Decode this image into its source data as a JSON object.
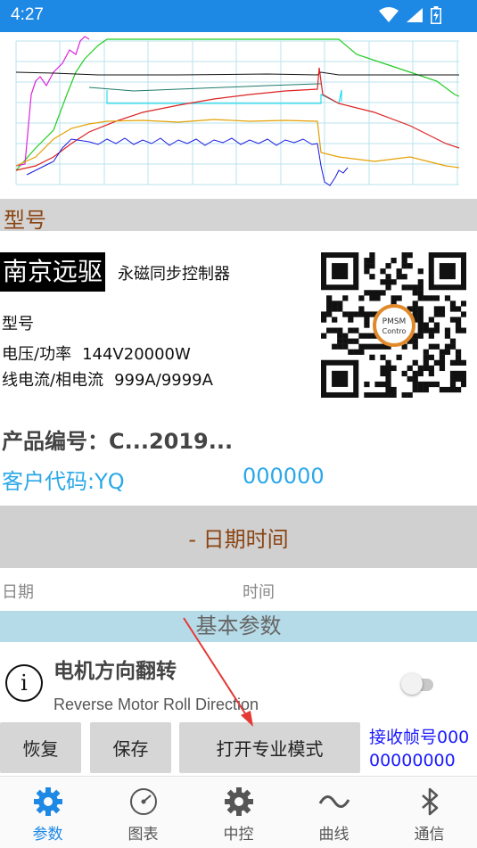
{
  "status": {
    "time": "4:27"
  },
  "model_section": {
    "title": "型号"
  },
  "device": {
    "brand": "南京远驱",
    "brand_suffix": "永磁同步控制器",
    "model_label": "型号",
    "voltage_label": "电压/功率",
    "voltage_value": "144V20000W",
    "current_label": "线电流/相电流",
    "current_value": "999A/9999A",
    "qr_logo_line1": "PMSM",
    "qr_logo_line2": "Contro"
  },
  "product": {
    "label": "产品编号：C...2019..."
  },
  "client": {
    "label": "客户代码:YQ",
    "number": "000000"
  },
  "datetime": {
    "button_label": "- 日期时间",
    "date_hint": "日期",
    "time_hint": "时间"
  },
  "basic_params": {
    "title": "基本参数"
  },
  "setting": {
    "title": "电机方向翻转",
    "subtitle": "Reverse Motor Roll Direction",
    "toggle_on": false
  },
  "buttons": {
    "restore": "恢复",
    "save": "保存",
    "pro_mode": "打开专业模式"
  },
  "frames": {
    "text": "接收帧号00000000000"
  },
  "nav": [
    {
      "label": "参数",
      "icon": "gear-icon",
      "active": true
    },
    {
      "label": "图表",
      "icon": "gauge-icon",
      "active": false
    },
    {
      "label": "中控",
      "icon": "gear-icon",
      "active": false
    },
    {
      "label": "曲线",
      "icon": "wave-icon",
      "active": false
    },
    {
      "label": "通信",
      "icon": "bluetooth-icon",
      "active": false
    }
  ],
  "colors": {
    "accent": "#1e88e5",
    "cyan_text": "#2aa8e8",
    "brown_text": "#8b4513",
    "frame_text": "#1a1aff"
  }
}
